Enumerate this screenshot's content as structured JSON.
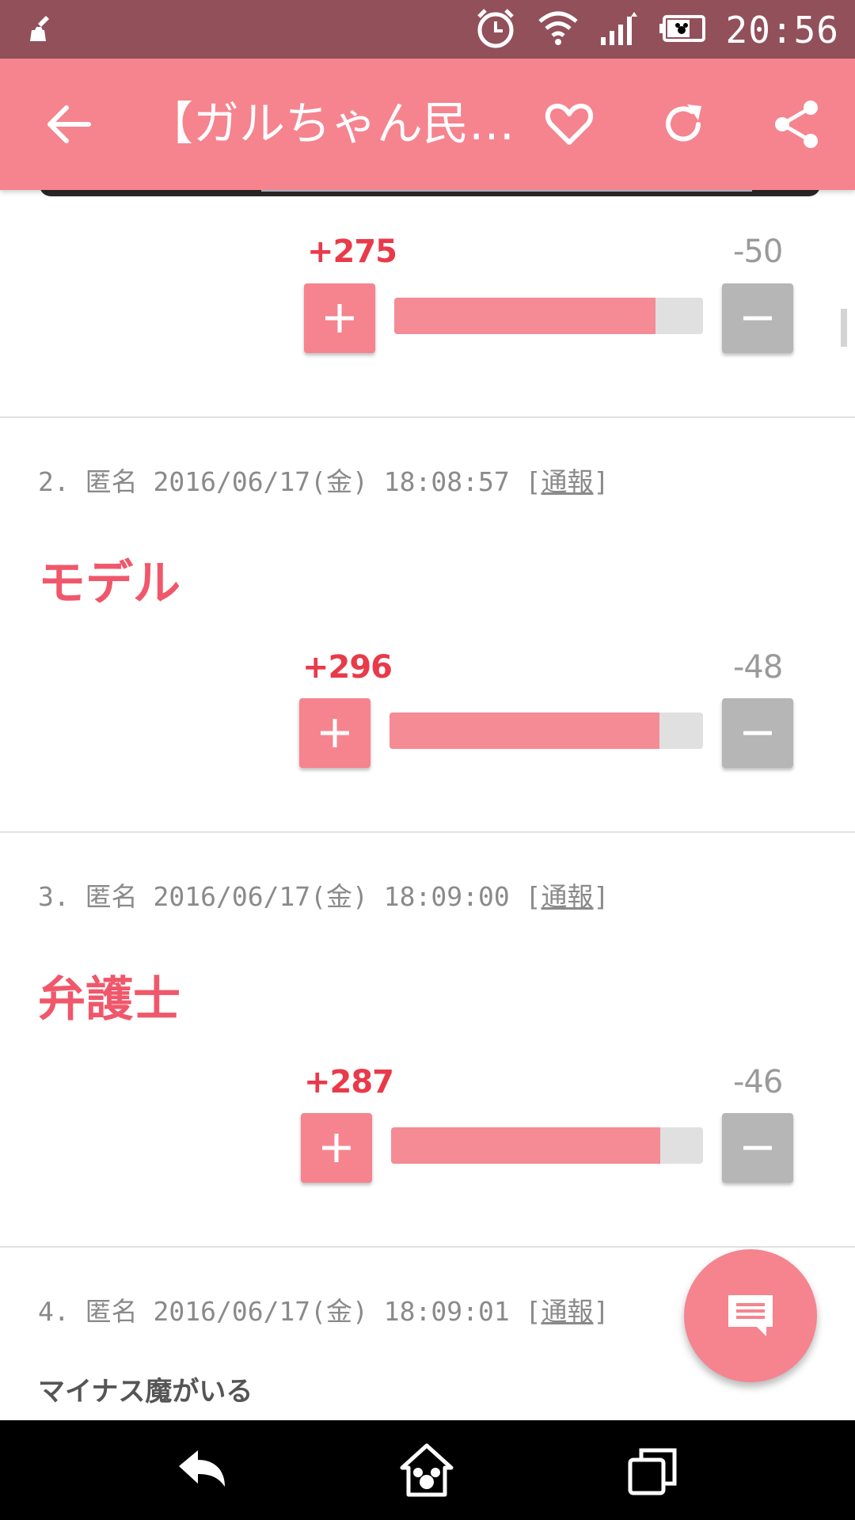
{
  "status_bar": {
    "time": "20:56",
    "icons": [
      "cleaner-icon",
      "alarm-icon",
      "wifi-icon",
      "signal-icon",
      "battery-icon"
    ]
  },
  "app_bar": {
    "title": "【ガルちゃん民…",
    "actions": [
      "back-arrow-icon",
      "heart-icon",
      "refresh-icon",
      "share-icon"
    ]
  },
  "colors": {
    "status_bar": "#92505a",
    "accent": "#f5848f",
    "plus_text": "#e93a4a",
    "comment_text": "#f0576a",
    "minus_button": "#b6b6b6"
  },
  "comments": [
    {
      "plus": "+275",
      "minus": "-50",
      "plus_value": 275,
      "minus_value": 50
    },
    {
      "number": "2.",
      "name": "匿名",
      "datetime": "2016/06/17(金) 18:08:57",
      "report": "通報",
      "body": "モデル",
      "plus": "+296",
      "minus": "-48",
      "plus_value": 296,
      "minus_value": 48
    },
    {
      "number": "3.",
      "name": "匿名",
      "datetime": "2016/06/17(金) 18:09:00",
      "report": "通報",
      "body": "弁護士",
      "plus": "+287",
      "minus": "-46",
      "plus_value": 287,
      "minus_value": 46
    },
    {
      "number": "4.",
      "name": "匿名",
      "datetime": "2016/06/17(金) 18:09:01",
      "report": "通報",
      "body": "マイナス魔がいる"
    }
  ],
  "fab": {
    "icon": "comment-icon"
  },
  "nav_bar": {
    "icons": [
      "back-nav-icon",
      "home-nav-icon",
      "recents-nav-icon"
    ]
  }
}
